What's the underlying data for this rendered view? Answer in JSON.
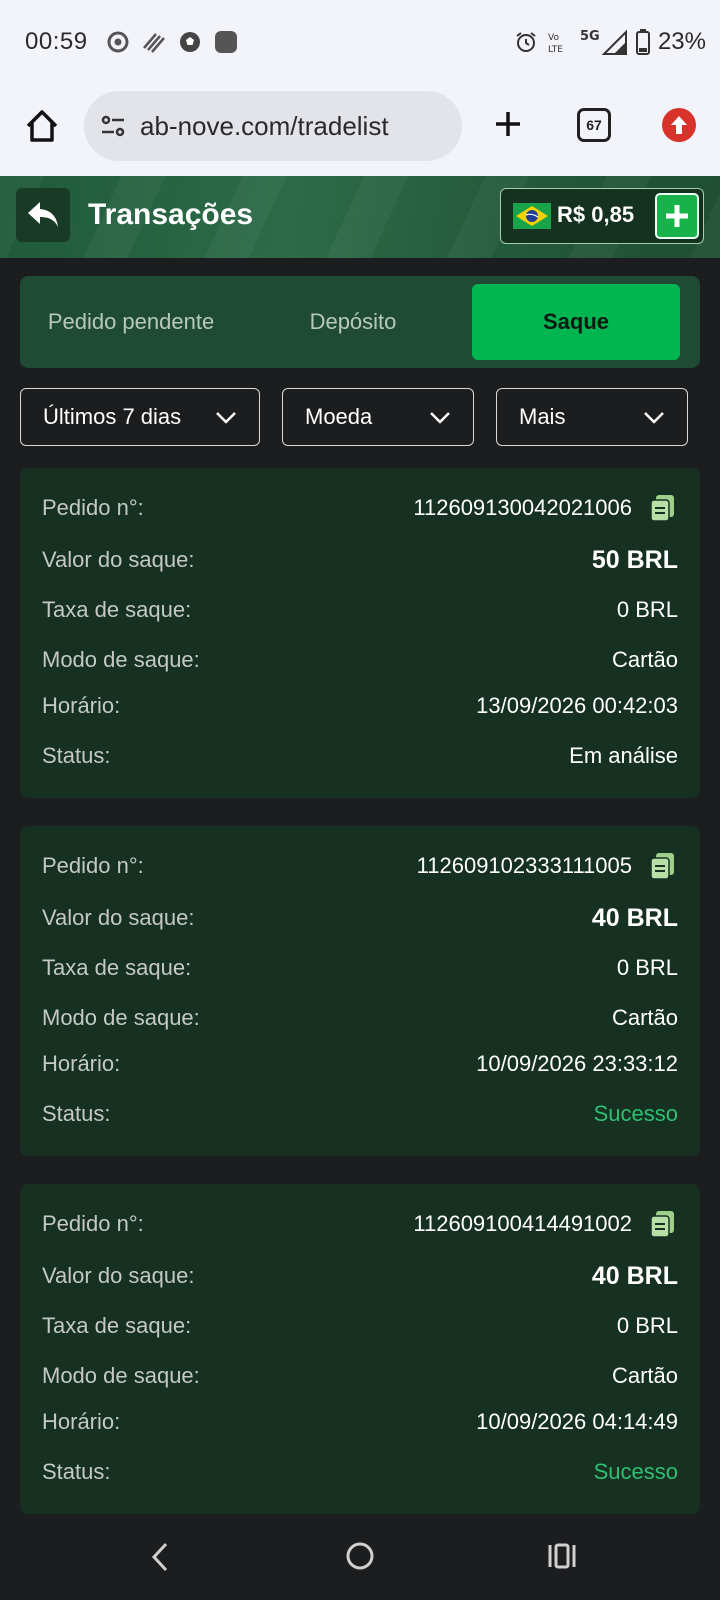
{
  "status_bar": {
    "time": "00:59",
    "battery": "23%",
    "network": "5G",
    "volte": "Vo LTE",
    "icons_left": [
      "chrome-icon",
      "stripes-icon",
      "soccer-ball-icon",
      "app-square-icon"
    ],
    "icons_right": [
      "alarm-icon",
      "volte-icon",
      "signal-icon",
      "battery-icon"
    ]
  },
  "browser": {
    "url": "ab-nove.com/tradelist",
    "tab_count": "67"
  },
  "header": {
    "title": "Transações",
    "balance": "R$ 0,85"
  },
  "tabs": [
    {
      "label": "Pedido pendente",
      "active": false
    },
    {
      "label": "Depósito",
      "active": false
    },
    {
      "label": "Saque",
      "active": true
    }
  ],
  "filters": {
    "period": "Últimos 7 dias",
    "currency": "Moeda",
    "more": "Mais"
  },
  "labels": {
    "order": "Pedido n°:",
    "amount": "Valor do saque:",
    "fee": "Taxa de saque:",
    "mode": "Modo de saque:",
    "time": "Horário:",
    "status": "Status:"
  },
  "transactions": [
    {
      "order_no": "112609130042021006",
      "amount": "50 BRL",
      "fee": "0 BRL",
      "mode": "Cartão",
      "time": "13/09/2026 00:42:03",
      "status": "Em análise"
    },
    {
      "order_no": "112609102333111005",
      "amount": "40 BRL",
      "fee": "0 BRL",
      "mode": "Cartão",
      "time": "10/09/2026 23:33:12",
      "status": "Sucesso"
    },
    {
      "order_no": "112609100414491002",
      "amount": "40 BRL",
      "fee": "0 BRL",
      "mode": "Cartão",
      "time": "10/09/2026 04:14:49",
      "status": "Sucesso"
    }
  ],
  "colors": {
    "accent": "#00b651",
    "success": "#2fbf72",
    "card_bg": "#163022"
  }
}
